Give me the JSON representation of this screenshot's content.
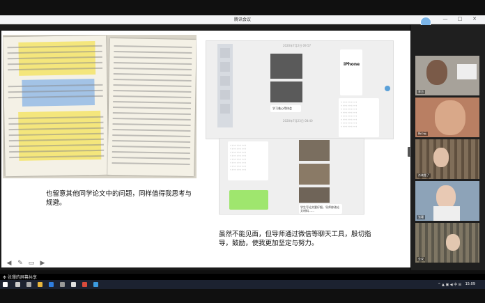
{
  "window": {
    "title": "腾讯会议",
    "controls": [
      "—",
      "□",
      "✕"
    ]
  },
  "slide": {
    "caption_left": "也留意其他同学论文中的问题，同样值得我思考与规避。",
    "caption_right": "虽然不能见面，但导师通过微信等聊天工具，殷切指导，鼓励，使我更加坚定与努力。",
    "chat1": {
      "stamp_top": "2020年7月2日 09:57",
      "stamp_mid": "2020年7月23日 08:40",
      "iphone_label": "iPhone",
      "bubble_note": "学习着心得体会"
    },
    "chat2": {
      "bubble_note": "学生写论文要仔细，导师修改论文材料……"
    }
  },
  "tools": [
    "arrow-left",
    "pen",
    "screen",
    "arrow-right"
  ],
  "sidebar": {
    "header": "正在讲话: 张珊",
    "tiles": [
      {
        "name": "李方"
      },
      {
        "name": "杨小云"
      },
      {
        "name": "肖晓霞了"
      },
      {
        "name": "张珊"
      },
      {
        "name": "会议"
      }
    ]
  },
  "share_bar": {
    "label": "❉ 张珊的屏幕共享"
  },
  "taskbar": {
    "tray_text": "^ ▲ ▣ ◀ 中 ⊞",
    "clock": "15:09"
  }
}
